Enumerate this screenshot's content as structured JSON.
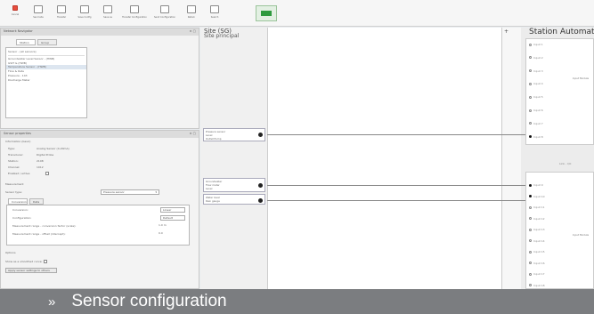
{
  "toolbar": {
    "buttons": [
      {
        "label": "Cancel",
        "icon": "close-icon"
      },
      {
        "label": "Send site",
        "icon": "send-icon"
      },
      {
        "label": "Transfer",
        "icon": "transfer-icon"
      },
      {
        "label": "Save Config",
        "icon": "save-icon"
      },
      {
        "label": "Save as",
        "icon": "save-as-icon"
      },
      {
        "label": "Transfer Configuration",
        "icon": "upload-icon"
      },
      {
        "label": "Send Configuration",
        "icon": "send-config-icon"
      },
      {
        "label": "Return",
        "icon": "return-icon"
      },
      {
        "label": "Search",
        "icon": "search-icon"
      },
      {
        "label": "Online Monitor",
        "icon": "monitor-icon"
      }
    ]
  },
  "top_panel": {
    "title": "Network Navigator",
    "tabs": [
      "Station",
      "Group"
    ],
    "filter_label": "Sensor - (all sensors)",
    "items": [
      "Groundwater Level Sensor - (HWB)",
      "GWT & (HWB)",
      "Temperature Sensor - (HWB)",
      "Flow & Rate",
      "Pressure - 143",
      "Discharge Meter"
    ]
  },
  "bottom_panel": {
    "title": "Sensor properties",
    "section_info": "Information (basic)",
    "fields": [
      {
        "label": "Type:",
        "value": "Analog Sensor (4-20mA)"
      },
      {
        "label": "Transducer:",
        "value": "Digital Probe"
      },
      {
        "label": "Station:",
        "value": "2108"
      },
      {
        "label": "Channel:",
        "value": "1012"
      },
      {
        "label": "Enabled / active:",
        "value": ""
      }
    ],
    "section_measure": "Measurement",
    "sensor_type_label": "Sensor type:",
    "sensor_type_value": "Pressure sensor",
    "tabs": [
      "Conversion",
      "Data"
    ],
    "rows": [
      {
        "label": "Conversion:",
        "value": "Linear"
      },
      {
        "label": "Configuration:",
        "value": "Default"
      },
      {
        "label": "Measurement range - conversion factor (scale):",
        "value": "1.0 m"
      },
      {
        "label": "Measurement range - offset (intercept):",
        "value": "0.0"
      }
    ],
    "section_extra": "Options",
    "option_label": "Show as a smoothed curve:",
    "apply_button": "Apply sensor settings to others"
  },
  "canvas": {
    "site_title": "Site (SG)",
    "site_subtitle": "Site principal",
    "plus": "+",
    "nodes": [
      {
        "lines": [
          "Pressure sensor",
          "Level",
          "Outlet Pump"
        ]
      },
      {
        "lines": [
          "Groundwater",
          "Flow meter",
          "Level"
        ]
      },
      {
        "lines": [
          "Water level",
          "Rain gauge"
        ]
      }
    ],
    "station_title": "Station Automat",
    "station_upper_items": [
      "Input 1",
      "Input 2",
      "Input 3",
      "Input 4",
      "Input 5",
      "Input 6",
      "Input 7",
      "Input 8"
    ],
    "station_lower_items": [
      "Input 9",
      "Input 10",
      "Input 11",
      "Input 12",
      "Input 13",
      "Input 14",
      "Input 15",
      "Input 16",
      "Input 17",
      "Input 18"
    ],
    "station_side_upper": "Input Module",
    "station_side_lower": "Input Module",
    "divider_label": "Link - I/O"
  },
  "caption": {
    "arrow": "»",
    "text": "Sensor configuration"
  },
  "colors": {
    "caption_bg": "#7b7d80",
    "accent_green": "#2e9a3e"
  }
}
